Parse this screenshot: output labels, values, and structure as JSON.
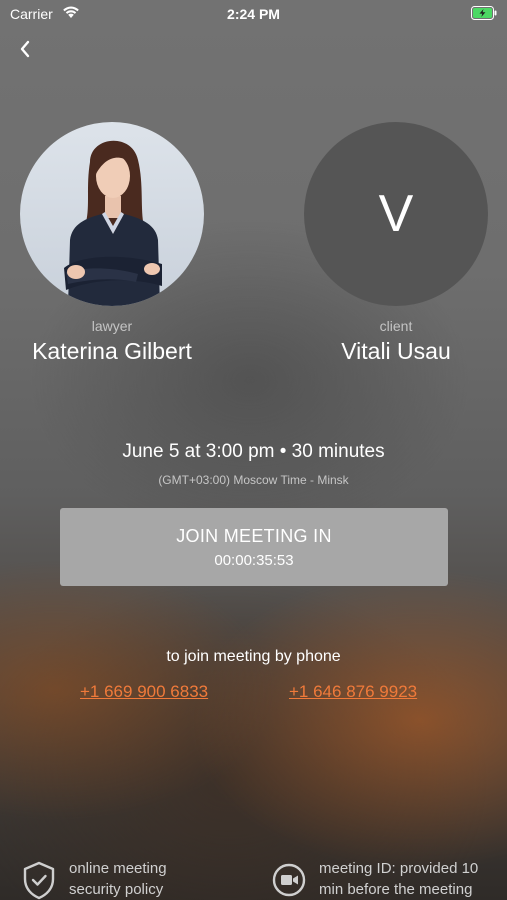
{
  "status_bar": {
    "carrier": "Carrier",
    "time": "2:24 PM",
    "icons": [
      "wifi-icon",
      "battery-charging-icon"
    ]
  },
  "navigation": {
    "back_icon": "chevron-left-icon"
  },
  "participants": [
    {
      "role": "lawyer",
      "name": "Katerina Gilbert",
      "avatar": "photo"
    },
    {
      "role": "client",
      "name": "Vitali Usau",
      "avatar_initial": "V"
    }
  ],
  "meeting": {
    "schedule": "June 5 at 3:00 pm • 30 minutes",
    "timezone": "(GMT+03:00) Moscow Time - Minsk",
    "join_label": "JOIN MEETING IN",
    "countdown": "00:00:35:53"
  },
  "phone": {
    "caption": "to join meeting by phone",
    "numbers": [
      "+1 669 900 6833",
      "+1 646 876 9923"
    ]
  },
  "footer": {
    "security": {
      "icon": "shield-check-icon",
      "line1": "online meeting",
      "line2": "security policy"
    },
    "meeting_id": {
      "icon": "video-camera-icon",
      "line1": "meeting ID: provided 10",
      "line2": "min before the meeting"
    }
  },
  "colors": {
    "link": "#f07a3a",
    "button": "#a7a7a7",
    "client_avatar": "#555555"
  }
}
